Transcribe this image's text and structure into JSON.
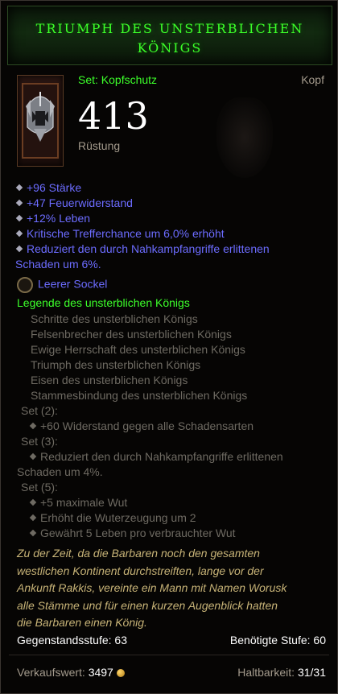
{
  "title_line1": "TRIUMPH DES UNSTERBLICHEN",
  "title_line2": "KÖNIGS",
  "set_type": "Set: Kopfschutz",
  "slot": "Kopf",
  "armor_value": "413",
  "armor_label": "Rüstung",
  "stats": [
    "+96 Stärke",
    "+47 Feuerwiderstand",
    "+12% Leben",
    "Kritische Trefferchance um 6,0% erhöht",
    "Reduziert den durch Nahkampfangriffe erlittenen",
    "Schaden um 6%."
  ],
  "socket": "Leerer Sockel",
  "set_name": "Legende des unsterblichen Königs",
  "set_items": [
    "Schritte des unsterblichen Königs",
    "Felsenbrecher des unsterblichen Königs",
    "Ewige Herrschaft des unsterblichen Königs",
    "Triumph des unsterblichen Königs",
    "Eisen des unsterblichen Königs",
    "Stammesbindung des unsterblichen Königs"
  ],
  "set_bonus": {
    "set2_label": "Set (2):",
    "set2_1": "+60 Widerstand gegen alle Schadensarten",
    "set3_label": "Set (3):",
    "set3_1": "Reduziert den durch Nahkampfangriffe erlittenen",
    "set3_2": "Schaden um 4%.",
    "set5_label": "Set (5):",
    "set5_1": "+5 maximale Wut",
    "set5_2": "Erhöht die Wuterzeugung um 2",
    "set5_3": "Gewährt 5 Leben pro verbrauchter Wut"
  },
  "flavor": [
    "Zu der Zeit, da die Barbaren noch den gesamten",
    "westlichen Kontinent durchstreiften, lange vor der",
    "Ankunft Rakkis, vereinte ein Mann mit Namen Worusk",
    "alle Stämme und für einen kurzen Augenblick hatten",
    "die Barbaren einen König."
  ],
  "item_level": "Gegenstandsstufe: 63",
  "required_level": "Benötigte Stufe: 60",
  "sell_label": "Verkaufswert: ",
  "sell_value": "3497",
  "durability_label": "Haltbarkeit: ",
  "durability_value": "31/31",
  "colors": {
    "title": "#3cff2a",
    "magic": "#6c6cff",
    "set": "#3cff2a",
    "inactive": "#6e6a62",
    "flavor": "#c7b377"
  },
  "icons": [
    "helm-icon",
    "gem-socket-icon",
    "gold-coin-icon"
  ]
}
